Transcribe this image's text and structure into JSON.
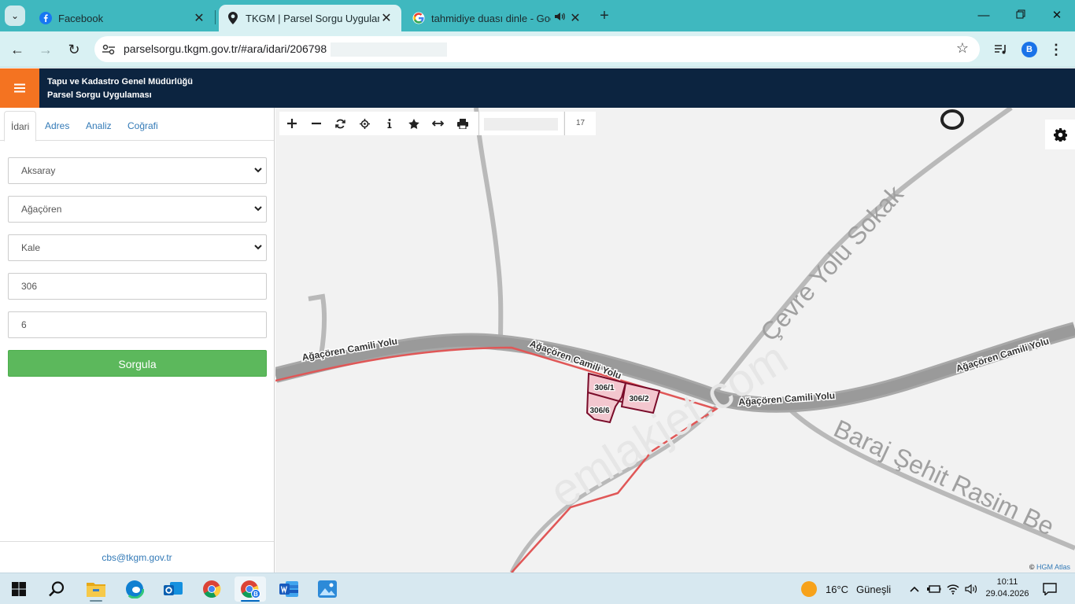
{
  "browser": {
    "tabs": [
      {
        "title": "Facebook",
        "icon": "facebook-icon",
        "active": false
      },
      {
        "title": "TKGM | Parsel Sorgu Uygulaması",
        "icon": "location-pin-icon",
        "active": true
      },
      {
        "title": "tahmidiye duası dinle - Google",
        "icon": "google-icon",
        "active": false,
        "audio": true
      }
    ],
    "url": "parselsorgu.tkgm.gov.tr/#ara/idari/206798",
    "profile_initial": "B"
  },
  "app": {
    "brand_line1": "Tapu ve Kadastro Genel Müdürlüğü",
    "brand_line2": "Parsel Sorgu Uygulaması",
    "accent": "#f47321",
    "header_color": "#0c2440"
  },
  "sidebar": {
    "tabs": [
      "İdari",
      "Adres",
      "Analiz",
      "Coğrafi"
    ],
    "active_tab": "İdari",
    "province": "Aksaray",
    "district": "Ağaçören",
    "neighborhood": "Kale",
    "block": "306",
    "parcel": "6",
    "query_button": "Sorgula",
    "footer_email": "cbs@tkgm.gov.tr"
  },
  "map": {
    "zoom_level": "17",
    "attribution_prefix": "©",
    "attribution_link": "HGM Atlas",
    "road_labels": [
      "Ağaçören Camili Yolu",
      "Ağaçören Camili Yolu",
      "Ağaçören Camili Yolu",
      "Ağaçören Camili Yolu",
      "Çevre Yolu Sokak",
      "Baraj Şehit Rasim Be"
    ],
    "parcels": [
      "306/1",
      "306/2",
      "306/6"
    ],
    "watermark": "emlakjet.com"
  },
  "taskbar": {
    "temperature": "16°C",
    "weather_text": "Güneşli",
    "time": "10:11",
    "date": "29.04.2026"
  }
}
